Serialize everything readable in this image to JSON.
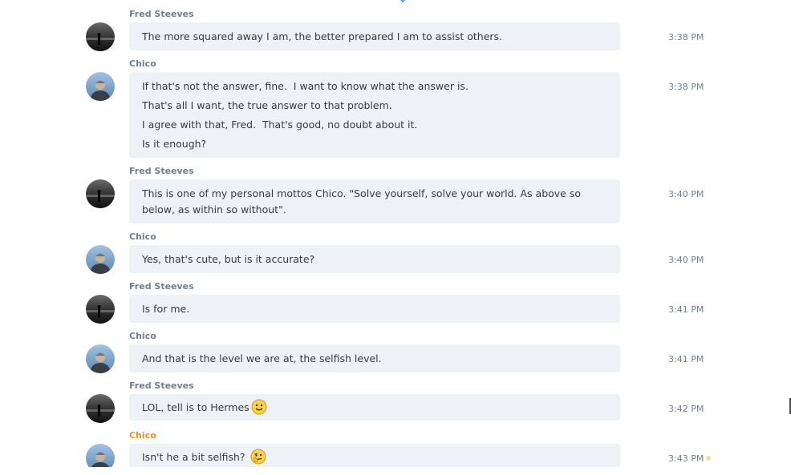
{
  "conversation": {
    "messages": [
      {
        "sender": "Fred Steeves",
        "avatar": "fred-avatar",
        "time": "3:38 PM",
        "lines": [
          "The more squared away I am, the better prepared I am to assist others."
        ]
      },
      {
        "sender": "Chico",
        "avatar": "chico-avatar",
        "time": "3:38 PM",
        "lines": [
          "If that's not the answer, fine.  I want to know what the answer is.",
          "That's all I want, the true answer to that problem.",
          "I agree with that, Fred.  That's good, no doubt about it.",
          "Is it enough?"
        ]
      },
      {
        "sender": "Fred Steeves",
        "avatar": "fred-avatar",
        "time": "3:40 PM",
        "lines": [
          "This is one of my personal mottos Chico. \"Solve yourself, solve your world. As above so below, as within so without\"."
        ]
      },
      {
        "sender": "Chico",
        "avatar": "chico-avatar",
        "time": "3:40 PM",
        "lines": [
          "Yes, that's cute, but is it accurate?"
        ]
      },
      {
        "sender": "Fred Steeves",
        "avatar": "fred-avatar",
        "time": "3:41 PM",
        "lines": [
          "Is for me."
        ]
      },
      {
        "sender": "Chico",
        "avatar": "chico-avatar",
        "time": "3:41 PM",
        "lines": [
          "And that is the level we are at, the selfish level."
        ]
      },
      {
        "sender": "Fred Steeves",
        "avatar": "fred-avatar",
        "time": "3:42 PM",
        "lines": [
          "LOL, tell is to Hermes"
        ],
        "emoji": "smile-emoji"
      },
      {
        "sender": "Chico",
        "avatar": "chico-avatar",
        "time": "3:43 PM",
        "lines": [
          "Isn't he a bit selfish? "
        ],
        "emoji": "thinking-emoji",
        "sender_color": "#f28c1f"
      }
    ]
  },
  "colors": {
    "bubble_bg": "#eef2f7",
    "sender_text": "#6f7f8e",
    "active_sender": "#f28c1f",
    "message_text": "#3a3a3a"
  }
}
